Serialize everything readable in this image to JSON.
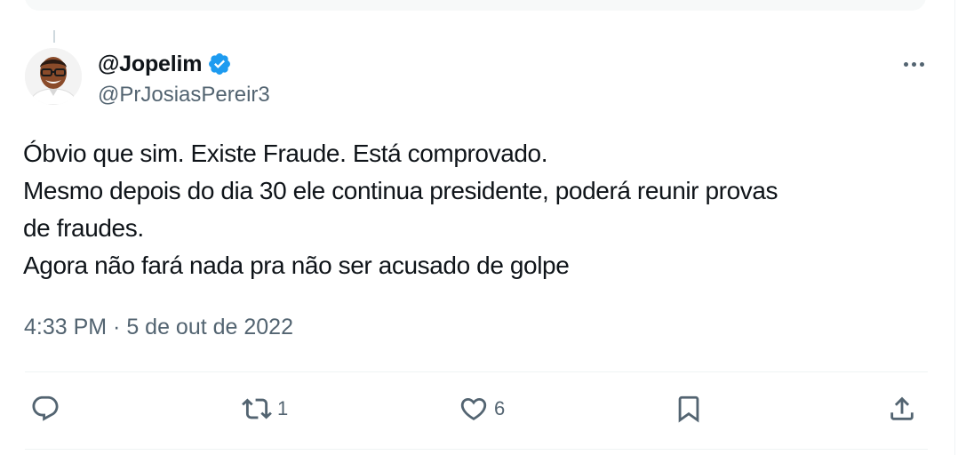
{
  "tweet": {
    "author": {
      "display_name": "@Jopelim",
      "handle": "@PrJosiasPereir3",
      "verified": true
    },
    "text_lines": [
      "Óbvio que sim. Existe Fraude. Está comprovado.",
      "Mesmo depois do dia 30 ele continua presidente, poderá reunir provas",
      "de fraudes.",
      "Agora não fará nada pra não ser acusado de golpe"
    ],
    "timestamp": "4:33 PM · 5 de out de 2022",
    "actions": {
      "reply": {
        "icon": "reply-icon",
        "count": ""
      },
      "repost": {
        "icon": "repost-icon",
        "count": "1"
      },
      "like": {
        "icon": "heart-icon",
        "count": "6"
      },
      "bookmark": {
        "icon": "bookmark-icon",
        "count": ""
      },
      "share": {
        "icon": "share-icon",
        "count": ""
      }
    }
  },
  "colors": {
    "text_primary": "#0f1419",
    "text_secondary": "#536471",
    "verified_blue": "#1d9bf0",
    "divider": "#eff3f4"
  }
}
